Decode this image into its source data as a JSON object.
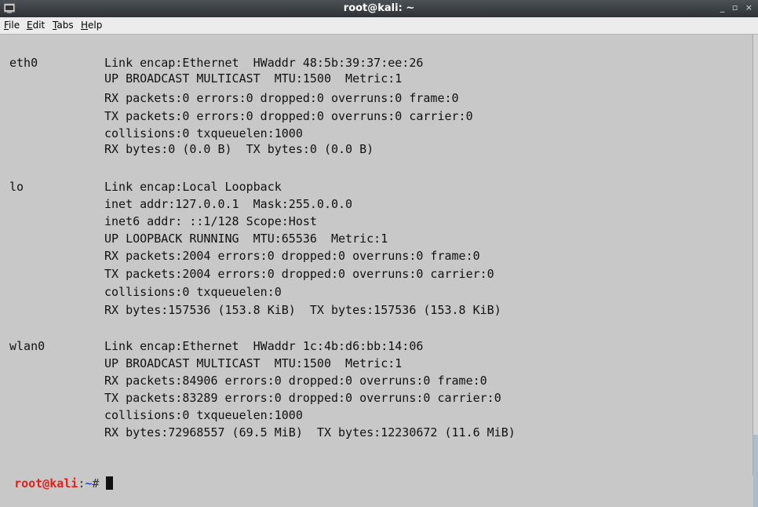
{
  "window": {
    "title": "root@kali: ~",
    "controls": "_ ▫ ×"
  },
  "menu": [
    {
      "label": "File",
      "key": "F",
      "rest": "ile"
    },
    {
      "label": "Edit",
      "key": "E",
      "rest": "dit"
    },
    {
      "label": "Tabs",
      "key": "T",
      "rest": "abs"
    },
    {
      "label": "Help",
      "key": "H",
      "rest": "elp"
    }
  ],
  "blocks": [
    {
      "iface": "eth0",
      "lines": [
        "Link encap:Ethernet  HWaddr 48:5b:39:37:ee:26",
        "UP BROADCAST MULTICAST  MTU:1500  Metric:1",
        "RX packets:0 errors:0 dropped:0 overruns:0 frame:0",
        "TX packets:0 errors:0 dropped:0 overruns:0 carrier:0",
        "collisions:0 txqueuelen:1000",
        "RX bytes:0 (0.0 B)  TX bytes:0 (0.0 B)"
      ]
    },
    {
      "iface": "lo",
      "lines": [
        "Link encap:Local Loopback",
        "inet addr:127.0.0.1  Mask:255.0.0.0",
        "inet6 addr: ::1/128 Scope:Host",
        "UP LOOPBACK RUNNING  MTU:65536  Metric:1",
        "RX packets:2004 errors:0 dropped:0 overruns:0 frame:0",
        "TX packets:2004 errors:0 dropped:0 overruns:0 carrier:0",
        "collisions:0 txqueuelen:0",
        "RX bytes:157536 (153.8 KiB)  TX bytes:157536 (153.8 KiB)"
      ]
    },
    {
      "iface": "wlan0",
      "lines": [
        "Link encap:Ethernet  HWaddr 1c:4b:d6:bb:14:06",
        "UP BROADCAST MULTICAST  MTU:1500  Metric:1",
        "RX packets:84906 errors:0 dropped:0 overruns:0 frame:0",
        "TX packets:83289 errors:0 dropped:0 overruns:0 carrier:0",
        "collisions:0 txqueuelen:1000",
        "RX bytes:72968557 (69.5 MiB)  TX bytes:12230672 (11.6 MiB)"
      ]
    }
  ],
  "prompt": {
    "user_host": "root@kali",
    "sep": ":",
    "path": "~",
    "symbol": "# "
  },
  "colors": {
    "background": "#c8c8c8",
    "prompt_user": "#e0201c",
    "prompt_path": "#2a50d8"
  },
  "icons": {
    "window_icon": "terminal-icon",
    "cursor": "block-cursor"
  }
}
